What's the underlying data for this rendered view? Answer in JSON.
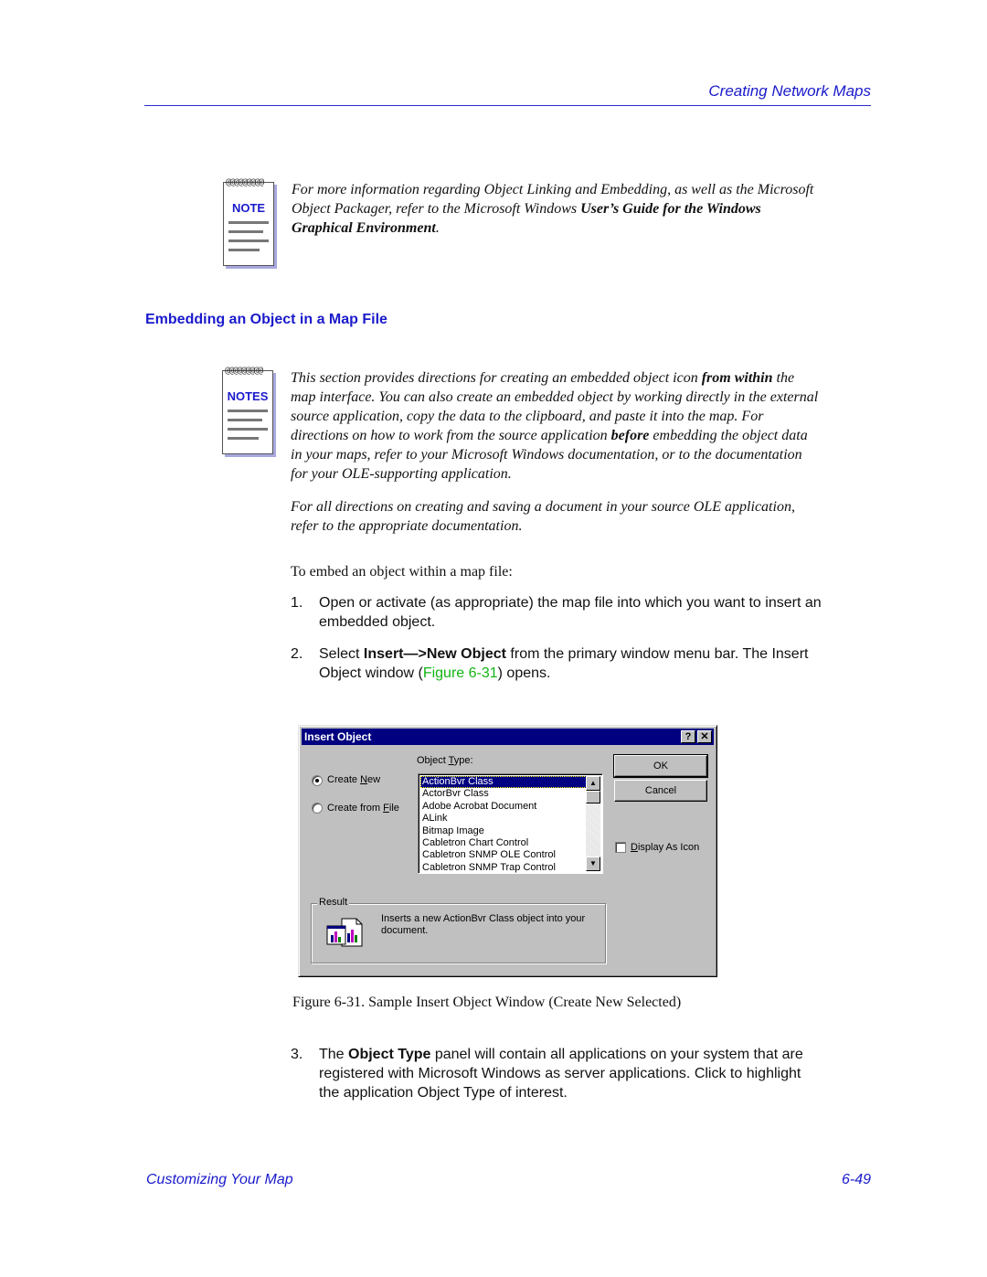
{
  "header": {
    "running_title": "Creating Network Maps"
  },
  "note1": {
    "icon_label": "NOTE",
    "text_1": "For more information regarding Object Linking and Embedding, as well as the Microsoft",
    "text_2a": "Object Packager, refer to the Microsoft Windows ",
    "text_2b": "User’s Guide for the Windows",
    "text_3a": "Graphical Environment",
    "text_3b": "."
  },
  "section": {
    "heading": "Embedding an Object in a Map File"
  },
  "note2": {
    "icon_label": "NOTES",
    "line_1a": "This section provides directions for creating an embedded object icon ",
    "line_1b": "from within",
    "line_1c": " the",
    "line_2": "map interface. You can also create an embedded object by working directly in the external",
    "line_3": "source application, copy the data to the clipboard, and paste it into the map. For",
    "line_4a": "directions on how to work from the source application ",
    "line_4b": "before",
    "line_4c": " embedding the object data",
    "line_5": "in your maps, refer to your Microsoft Windows documentation, or to the documentation",
    "line_6": "for your OLE-supporting application.",
    "para2_line_1": "For all directions on creating and saving a document in your source OLE application,",
    "para2_line_2": "refer to the appropriate documentation."
  },
  "intro": "To embed an object within a map file:",
  "steps": [
    {
      "num": "1.",
      "line_1": "Open or activate (as appropriate) the map file into which you want to insert an",
      "line_2": "embedded object."
    },
    {
      "num": "2.",
      "pre": "Select ",
      "bold": "Insert—>New Object",
      "post": " from the primary window menu bar. The Insert",
      "line_2_pre": "Object window (",
      "link": "Figure 6-31",
      "line_2_post": ") opens."
    },
    {
      "num": "3.",
      "pre": "The ",
      "bold": "Object Type",
      "post": " panel will contain all applications on your system that are",
      "line_2": "registered with Microsoft Windows as server applications. Click to highlight",
      "line_3": "the application Object Type of interest."
    }
  ],
  "dialog": {
    "title": "Insert Object",
    "help_btn": "?",
    "close_btn": "✕",
    "radio_create_new_pre": "Create ",
    "radio_create_new_u": "N",
    "radio_create_new_post": "ew",
    "radio_create_new_checked": true,
    "radio_from_file_pre": "Create from ",
    "radio_from_file_u": "F",
    "radio_from_file_post": "ile",
    "radio_from_file_checked": false,
    "object_type_label_pre": "Object ",
    "object_type_label_u": "T",
    "object_type_label_post": "ype:",
    "object_types": [
      "ActionBvr Class",
      "ActorBvr Class",
      "Adobe Acrobat Document",
      "ALink",
      "Bitmap Image",
      "Cabletron Chart Control",
      "Cabletron SNMP OLE Control",
      "Cabletron SNMP Trap Control"
    ],
    "selected_object_type": "ActionBvr Class",
    "scroll_up": "▲",
    "scroll_down": "▼",
    "ok_label": "OK",
    "cancel_label": "Cancel",
    "display_as_icon_u": "D",
    "display_as_icon_post": "isplay As Icon",
    "display_as_icon_checked": false,
    "result_legend": "Result",
    "result_text": "Inserts a new ActionBvr Class object into your document."
  },
  "figure_caption": "Figure 6-31.  Sample Insert Object Window (Create New Selected)",
  "footer": {
    "chapter": "Customizing Your Map",
    "page_number": "6-49"
  }
}
